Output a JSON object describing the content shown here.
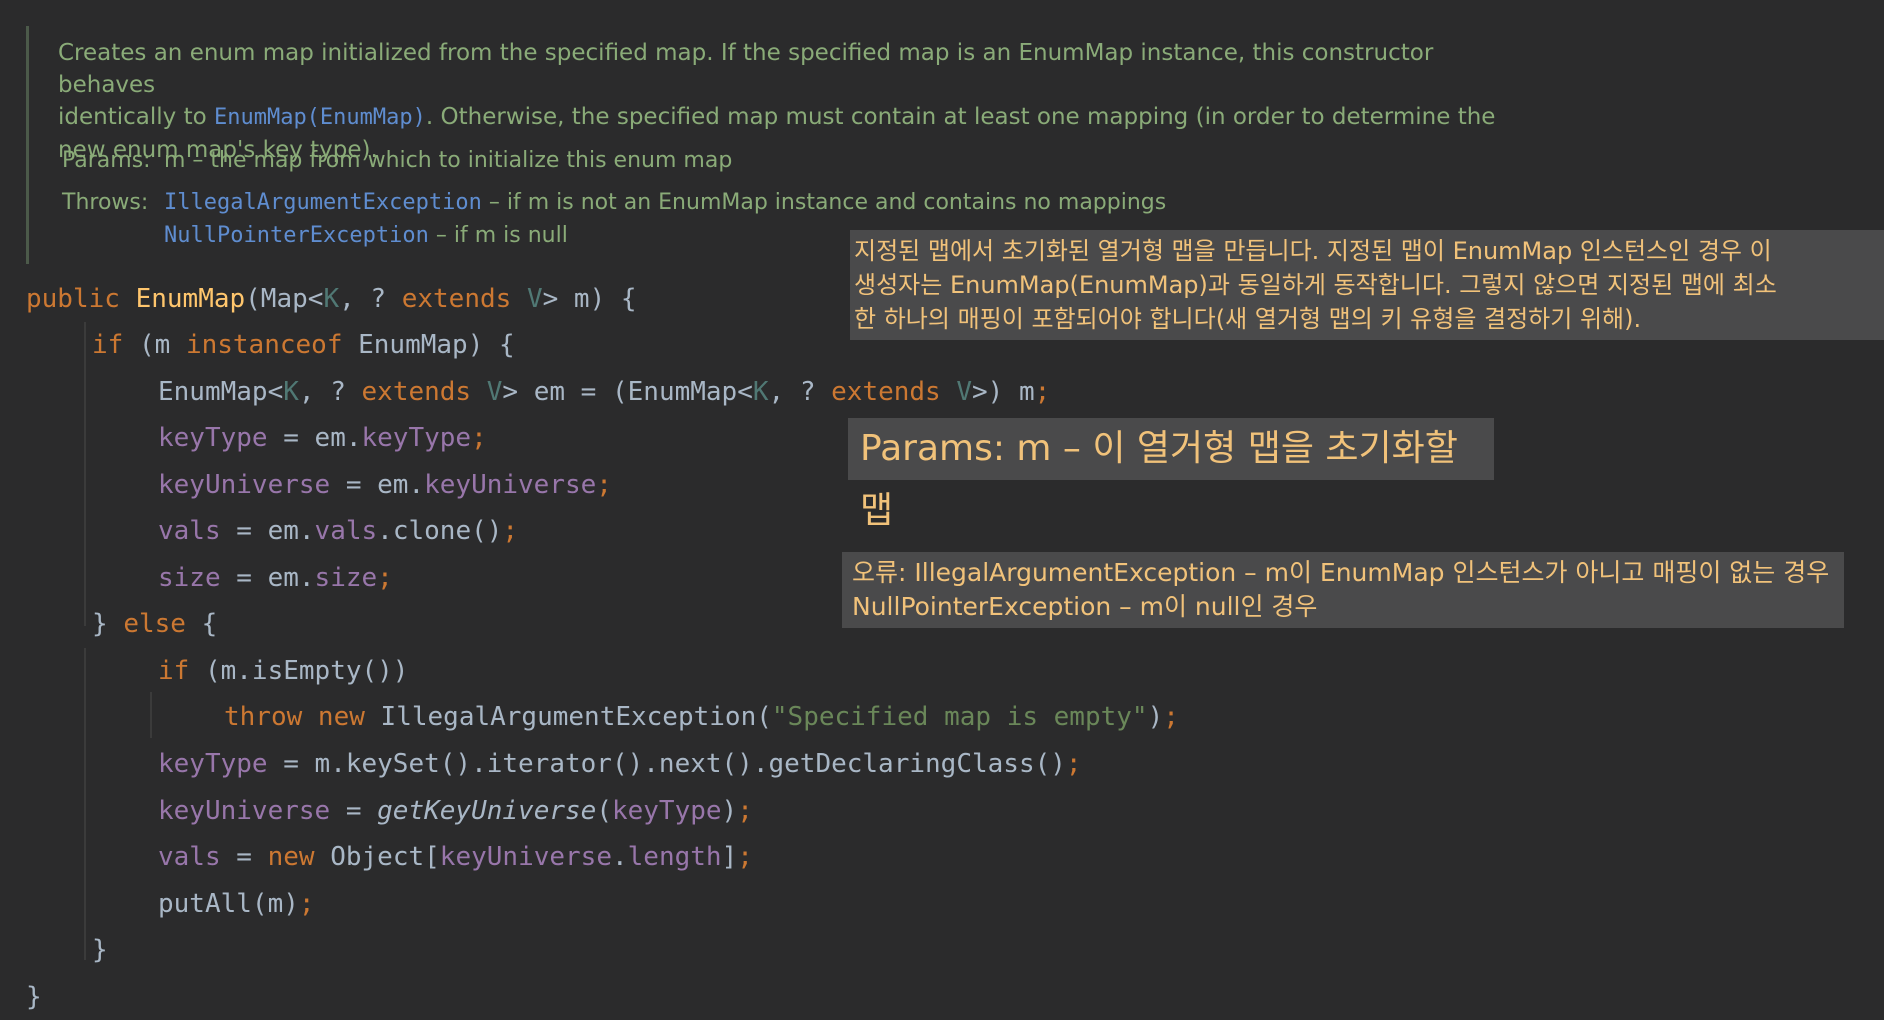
{
  "doc": {
    "line1": "Creates an enum map initialized from the specified map. If the specified map is an EnumMap instance, this constructor behaves",
    "line2_pre": "identically to ",
    "line2_link": "EnumMap(EnumMap)",
    "line2_post": ". Otherwise, the specified map must contain at least one mapping (in order to determine the",
    "line3": "new enum map's key type).",
    "params_label": "Params:",
    "params_text": "m – the map from which to initialize this enum map",
    "throws_label": "Throws:",
    "throws1_link": "IllegalArgumentException",
    "throws1_text": " – if m is not an EnumMap instance and contains no mappings",
    "throws2_link": "NullPointerException",
    "throws2_text": " – if m is null"
  },
  "code": {
    "l1": {
      "a": "public ",
      "b": "EnumMap",
      "c": "(Map<",
      "d": "K",
      "e": ", ? ",
      "f": "extends ",
      "g": "V",
      "h": "> m) {"
    },
    "l2": {
      "a": "if ",
      "b": "(m ",
      "c": "instanceof ",
      "d": "EnumMap) {"
    },
    "l3": {
      "a": "EnumMap<",
      "b": "K",
      "c": ", ? ",
      "d": "extends ",
      "e": "V",
      "f": "> em = (EnumMap<",
      "g": "K",
      "h": ", ? ",
      "i": "extends ",
      "j": "V",
      "k": ">) m",
      "l": ";"
    },
    "l4": {
      "a": "keyType",
      "b": " = em.",
      "c": "keyType",
      "d": ";"
    },
    "l5": {
      "a": "keyUniverse",
      "b": " = em.",
      "c": "keyUniverse",
      "d": ";"
    },
    "l6": {
      "a": "vals",
      "b": " = em.",
      "c": "vals",
      "d": ".clone()",
      "e": ";"
    },
    "l7": {
      "a": "size",
      "b": " = em.",
      "c": "size",
      "d": ";"
    },
    "l8": {
      "a": "} ",
      "b": "else ",
      "c": "{"
    },
    "l9": {
      "a": "if ",
      "b": "(m.isEmpty())"
    },
    "l10": {
      "a": "throw ",
      "b": "new ",
      "c": "IllegalArgumentException(",
      "d": "\"Specified map is empty\"",
      "e": ")",
      "f": ";"
    },
    "l11": {
      "a": "keyType",
      "b": " = m.keySet().iterator().next().getDeclaringClass()",
      "c": ";"
    },
    "l12": {
      "a": "keyUniverse",
      "b": " = ",
      "c": "getKeyUniverse",
      "d": "(",
      "e": "keyType",
      "f": ")",
      "g": ";"
    },
    "l13": {
      "a": "vals",
      "b": " = ",
      "c": "new ",
      "d": "Object[",
      "e": "keyUniverse",
      "f": ".",
      "g": "length",
      "h": "]",
      "i": ";"
    },
    "l14": {
      "a": "putAll(m)",
      "b": ";"
    },
    "l15": {
      "a": "}"
    },
    "l16": {
      "a": "}"
    }
  },
  "translation": {
    "desc_line1": "지정된 맵에서 초기화된 열거형 맵을 만듭니다. 지정된 맵이 EnumMap 인스턴스인 경우 이",
    "desc_line2": "생성자는 EnumMap(EnumMap)과 동일하게 동작합니다. 그렇지 않으면 지정된 맵에 최소",
    "desc_line3": "한 하나의 매핑이 포함되어야 합니다(새 열거형 맵의 키 유형을 결정하기 위해).",
    "params": "Params: m – 이 열거형 맵을 초기화할 맵",
    "throws_line1": "오류: IllegalArgumentException – m이 EnumMap 인스턴스가 아니고 매핑이 없는 경우",
    "throws_line2": "NullPointerException – m이 null인 경우"
  },
  "colors": {
    "background": "#2b2b2c",
    "doc_text": "#8aab78",
    "doc_link": "#5f8dd0",
    "keyword": "#cc7832",
    "method": "#ffc66d",
    "field": "#9876aa",
    "type_param": "#507874",
    "string": "#6a8759",
    "plain": "#a9b7c6",
    "overlay_bg": "#4a4a4b",
    "overlay_text": "#f1c27a"
  }
}
